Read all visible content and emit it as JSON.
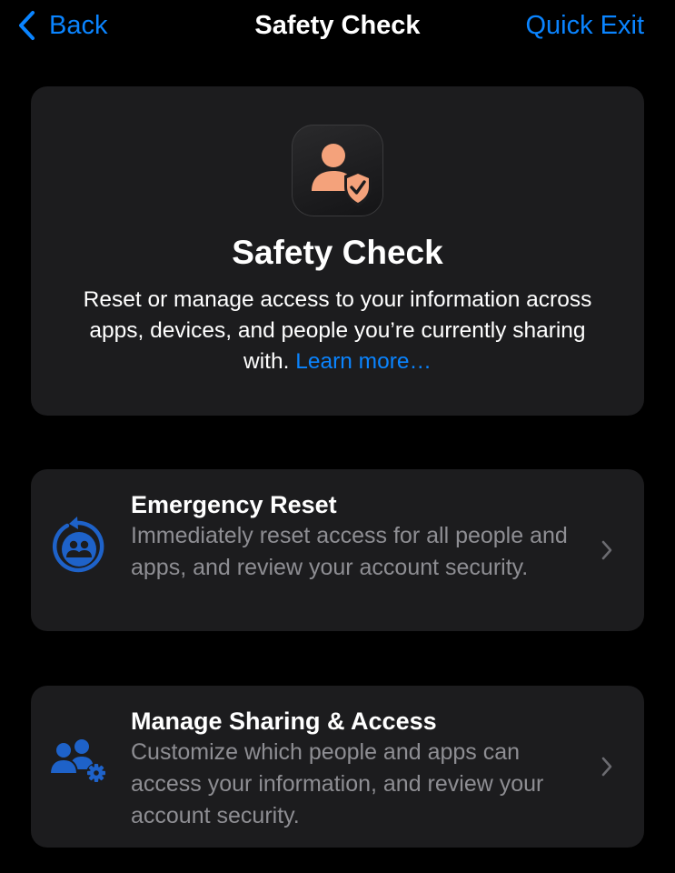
{
  "navbar": {
    "back_label": "Back",
    "title": "Safety Check",
    "quick_exit_label": "Quick Exit"
  },
  "header_card": {
    "icon": "person-shield-icon",
    "title": "Safety Check",
    "description": "Reset or manage access to your information across apps, devices, and people you’re currently sharing with.",
    "learn_more_label": "Learn more…"
  },
  "options": {
    "emergency_reset": {
      "icon": "emergency-reset-icon",
      "title": "Emergency Reset",
      "description": "Immediately reset access for all people and apps, and review your account security."
    },
    "manage_sharing": {
      "icon": "manage-sharing-icon",
      "title": "Manage Sharing & Access",
      "description": "Customize which people and apps can access your information, and review your account security."
    }
  },
  "colors": {
    "background": "#000000",
    "card": "#1c1c1e",
    "accent_blue": "#0a84ff",
    "icon_blue": "#1e62c9",
    "icon_orange": "#f4a27b",
    "secondary_text": "#8e8e93"
  }
}
